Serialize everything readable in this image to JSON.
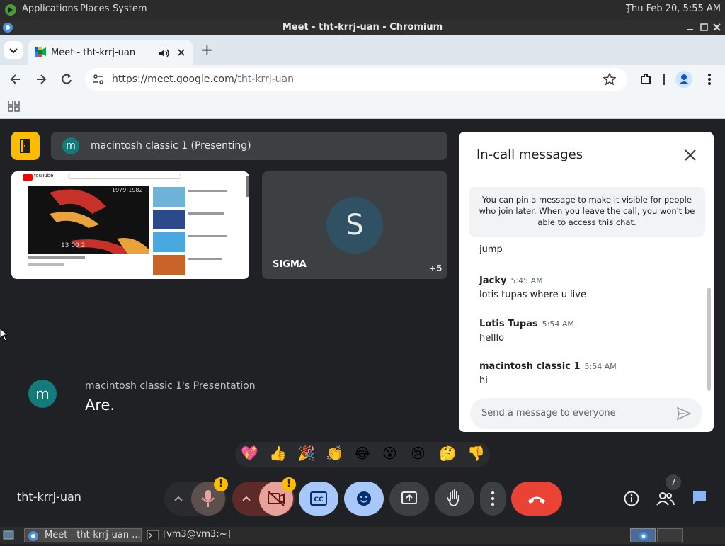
{
  "system_bar": {
    "applications": "Applications",
    "places": "Places",
    "system": "System",
    "clock": "Thu Feb 20,  5:55 AM"
  },
  "window": {
    "title": "Meet - tht-krrj-uan - Chromium"
  },
  "browser": {
    "tab_title": "Meet - tht-krrj-uan",
    "new_tab": "+",
    "url_host": "https://meet.google.com/",
    "url_path": "tht-krrj-uan"
  },
  "meet": {
    "presenting_initial": "m",
    "presenting_label": "macintosh classic 1 (Presenting)",
    "sigma_initial": "S",
    "sigma_name": "SIGMA",
    "sigma_more": "+5",
    "presentation_initial": "m",
    "presentation_title": "macintosh classic 1's Presentation",
    "presentation_caption": "Are.",
    "meeting_code": "tht-krrj-uan",
    "participant_count": "7",
    "thumbnail": {
      "logo": "YouTube",
      "years": "1979-1982",
      "clock": "13 00 2"
    }
  },
  "chat": {
    "title": "In-call messages",
    "pin_note": "You can pin a message to make it visible for people who join later. When you leave the call, you won't be able to access this chat.",
    "messages": [
      {
        "name": "",
        "time": "",
        "text": "jump"
      },
      {
        "name": "Jacky",
        "time": "5:45 AM",
        "text": "lotis tupas where u live"
      },
      {
        "name": "Lotis Tupas",
        "time": "5:54 AM",
        "text": "helllo"
      },
      {
        "name": "macintosh classic 1",
        "time": "5:54 AM",
        "text": "hi"
      }
    ],
    "input_placeholder": "Send a message to everyone"
  },
  "reactions": [
    "💖",
    "👍",
    "🎉",
    "👏",
    "😂",
    "😮",
    "😢",
    "🤔",
    "👎"
  ],
  "taskbar": {
    "task1": "Meet - tht-krrj-uan ...",
    "task2": "[vm3@vm3:~]"
  },
  "colors": {
    "meet_bg": "#202124",
    "hangup": "#ea4335",
    "active_blue": "#a8c7fa",
    "accent_yellow": "#fbbc04",
    "avatar_teal": "#137b7b"
  }
}
